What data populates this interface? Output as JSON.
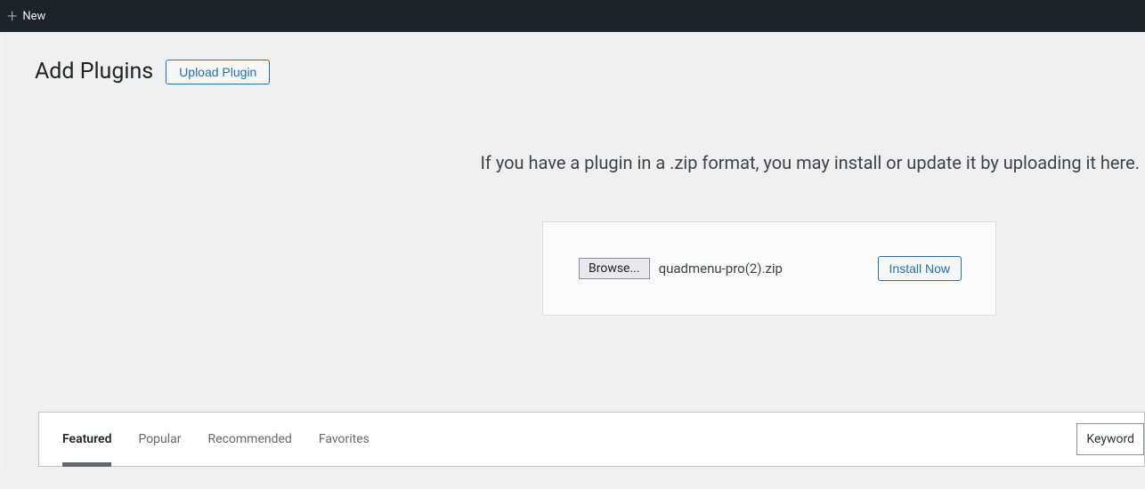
{
  "admin_bar": {
    "new_label": "New"
  },
  "page": {
    "title": "Add Plugins",
    "upload_button": "Upload Plugin",
    "instruction": "If you have a plugin in a .zip format, you may install or update it by uploading it here."
  },
  "upload_form": {
    "browse_label": "Browse...",
    "filename": "quadmenu-pro(2).zip",
    "install_label": "Install Now"
  },
  "filter": {
    "tabs": [
      "Featured",
      "Popular",
      "Recommended",
      "Favorites"
    ],
    "search_type": "Keyword"
  }
}
